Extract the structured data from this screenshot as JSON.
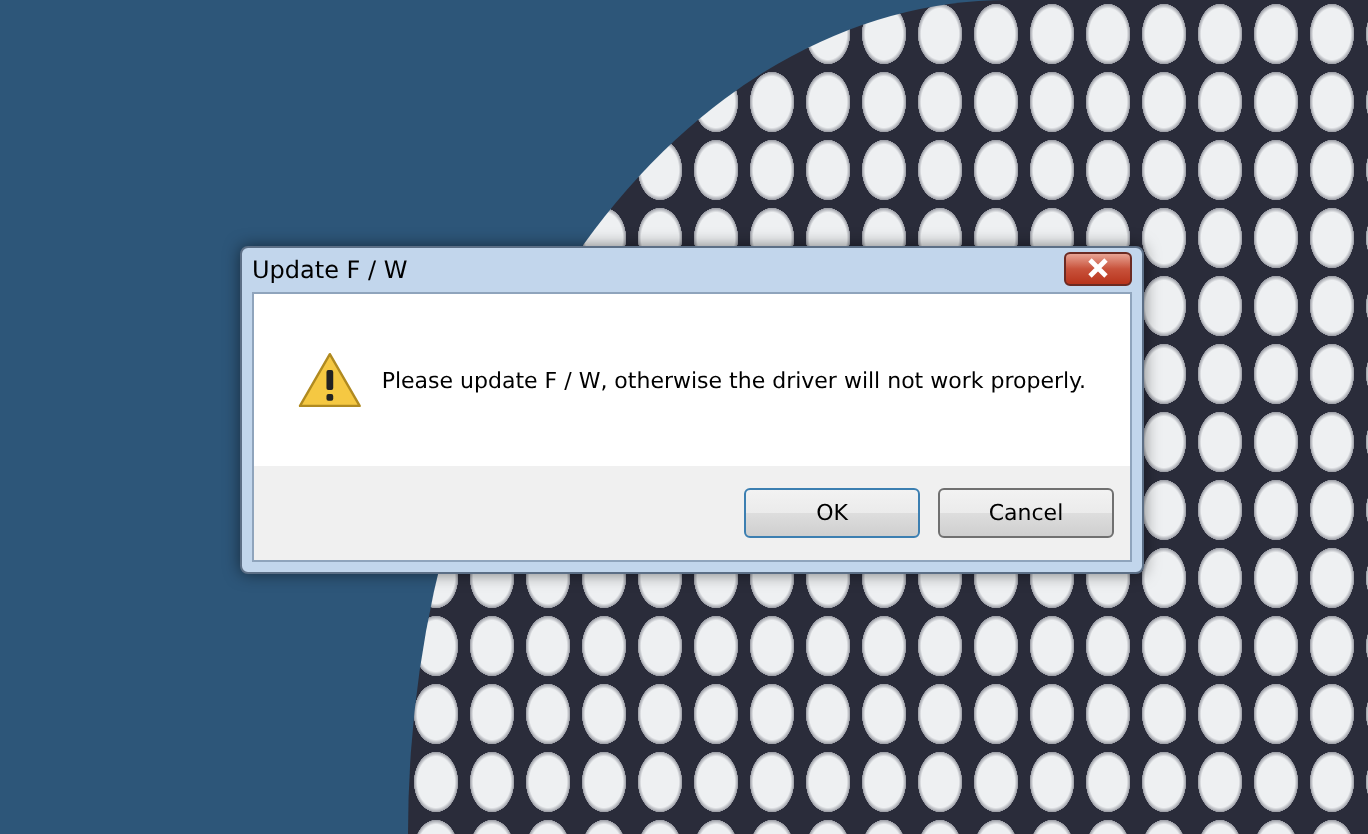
{
  "window": {
    "title": "Update F / W"
  },
  "message": "Please update F / W, otherwise the driver will not work properly.",
  "buttons": [
    "OK",
    "Cancel"
  ]
}
